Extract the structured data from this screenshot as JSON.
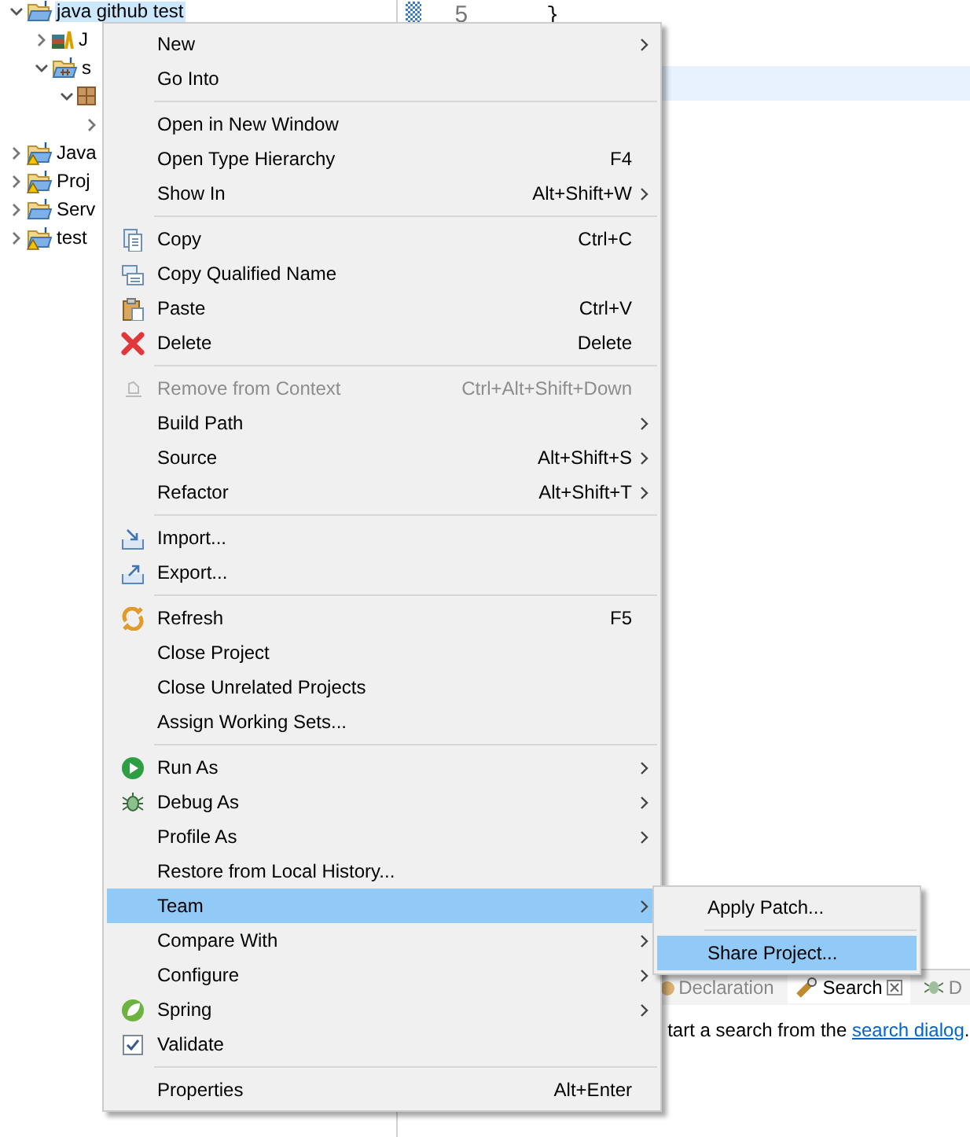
{
  "tree": [
    {
      "label": "java github test",
      "expanded": true,
      "selected": true,
      "warning": false,
      "kind": "project",
      "children": [
        {
          "label": "J",
          "expanded": false,
          "selected": false,
          "kind": "library"
        },
        {
          "label": "s",
          "expanded": true,
          "selected": false,
          "warning": false,
          "kind": "folder",
          "children": [
            {
              "expanded": true,
              "kind": "package",
              "children": [
                {
                  "expanded": false
                }
              ]
            }
          ]
        }
      ]
    },
    {
      "label": "Java",
      "expanded": false,
      "selected": false,
      "warning": true,
      "kind": "project"
    },
    {
      "label": "Proj",
      "expanded": false,
      "selected": false,
      "warning": true,
      "kind": "project"
    },
    {
      "label": "Serv",
      "expanded": false,
      "selected": false,
      "warning": false,
      "kind": "project"
    },
    {
      "label": "test",
      "expanded": false,
      "selected": false,
      "warning": true,
      "kind": "project"
    }
  ],
  "editor": {
    "lines": [
      {
        "number": "5",
        "code": "}"
      }
    ],
    "current_line": true
  },
  "context_menu": {
    "items": [
      {
        "kind": "command",
        "label": "New",
        "submenu": true
      },
      {
        "kind": "command",
        "label": "Go Into"
      },
      {
        "kind": "separator"
      },
      {
        "kind": "command",
        "label": "Open in New Window"
      },
      {
        "kind": "command",
        "label": "Open Type Hierarchy",
        "shortcut": "F4"
      },
      {
        "kind": "command",
        "label": "Show In",
        "shortcut": "Alt+Shift+W",
        "submenu": true
      },
      {
        "kind": "separator"
      },
      {
        "kind": "command",
        "label": "Copy",
        "shortcut": "Ctrl+C"
      },
      {
        "kind": "command",
        "label": "Copy Qualified Name"
      },
      {
        "kind": "command",
        "label": "Paste",
        "shortcut": "Ctrl+V"
      },
      {
        "kind": "command",
        "label": "Delete",
        "shortcut": "Delete"
      },
      {
        "kind": "separator"
      },
      {
        "kind": "command",
        "label": "Remove from Context",
        "shortcut": "Ctrl+Alt+Shift+Down",
        "disabled": true
      },
      {
        "kind": "command",
        "label": "Build Path",
        "submenu": true
      },
      {
        "kind": "command",
        "label": "Source",
        "shortcut": "Alt+Shift+S",
        "submenu": true
      },
      {
        "kind": "command",
        "label": "Refactor",
        "shortcut": "Alt+Shift+T",
        "submenu": true
      },
      {
        "kind": "separator"
      },
      {
        "kind": "command",
        "label": "Import..."
      },
      {
        "kind": "command",
        "label": "Export..."
      },
      {
        "kind": "separator"
      },
      {
        "kind": "command",
        "label": "Refresh",
        "shortcut": "F5"
      },
      {
        "kind": "command",
        "label": "Close Project"
      },
      {
        "kind": "command",
        "label": "Close Unrelated Projects"
      },
      {
        "kind": "command",
        "label": "Assign Working Sets..."
      },
      {
        "kind": "separator"
      },
      {
        "kind": "command",
        "label": "Run As",
        "submenu": true
      },
      {
        "kind": "command",
        "label": "Debug As",
        "submenu": true
      },
      {
        "kind": "command",
        "label": "Profile As",
        "submenu": true
      },
      {
        "kind": "command",
        "label": "Restore from Local History..."
      },
      {
        "kind": "command",
        "label": "Team",
        "submenu": true,
        "selected": true
      },
      {
        "kind": "command",
        "label": "Compare With",
        "submenu": true
      },
      {
        "kind": "command",
        "label": "Configure",
        "submenu": true
      },
      {
        "kind": "command",
        "label": "Spring",
        "submenu": true
      },
      {
        "kind": "command",
        "label": "Validate"
      },
      {
        "kind": "separator"
      },
      {
        "kind": "command",
        "label": "Properties",
        "shortcut": "Alt+Enter"
      }
    ]
  },
  "team_submenu": {
    "items": [
      {
        "kind": "command",
        "label": "Apply Patch...",
        "selected": false
      },
      {
        "kind": "separator"
      },
      {
        "kind": "command",
        "label": "Share Project...",
        "selected": true
      }
    ]
  },
  "bottom_panel": {
    "tabs": [
      {
        "label": "Declaration",
        "selected": false
      },
      {
        "label": "Search",
        "selected": true
      },
      {
        "label": "D",
        "selected": false
      }
    ],
    "message": {
      "text": "tart a search from the ",
      "link": "search dialog",
      "end": "."
    }
  }
}
